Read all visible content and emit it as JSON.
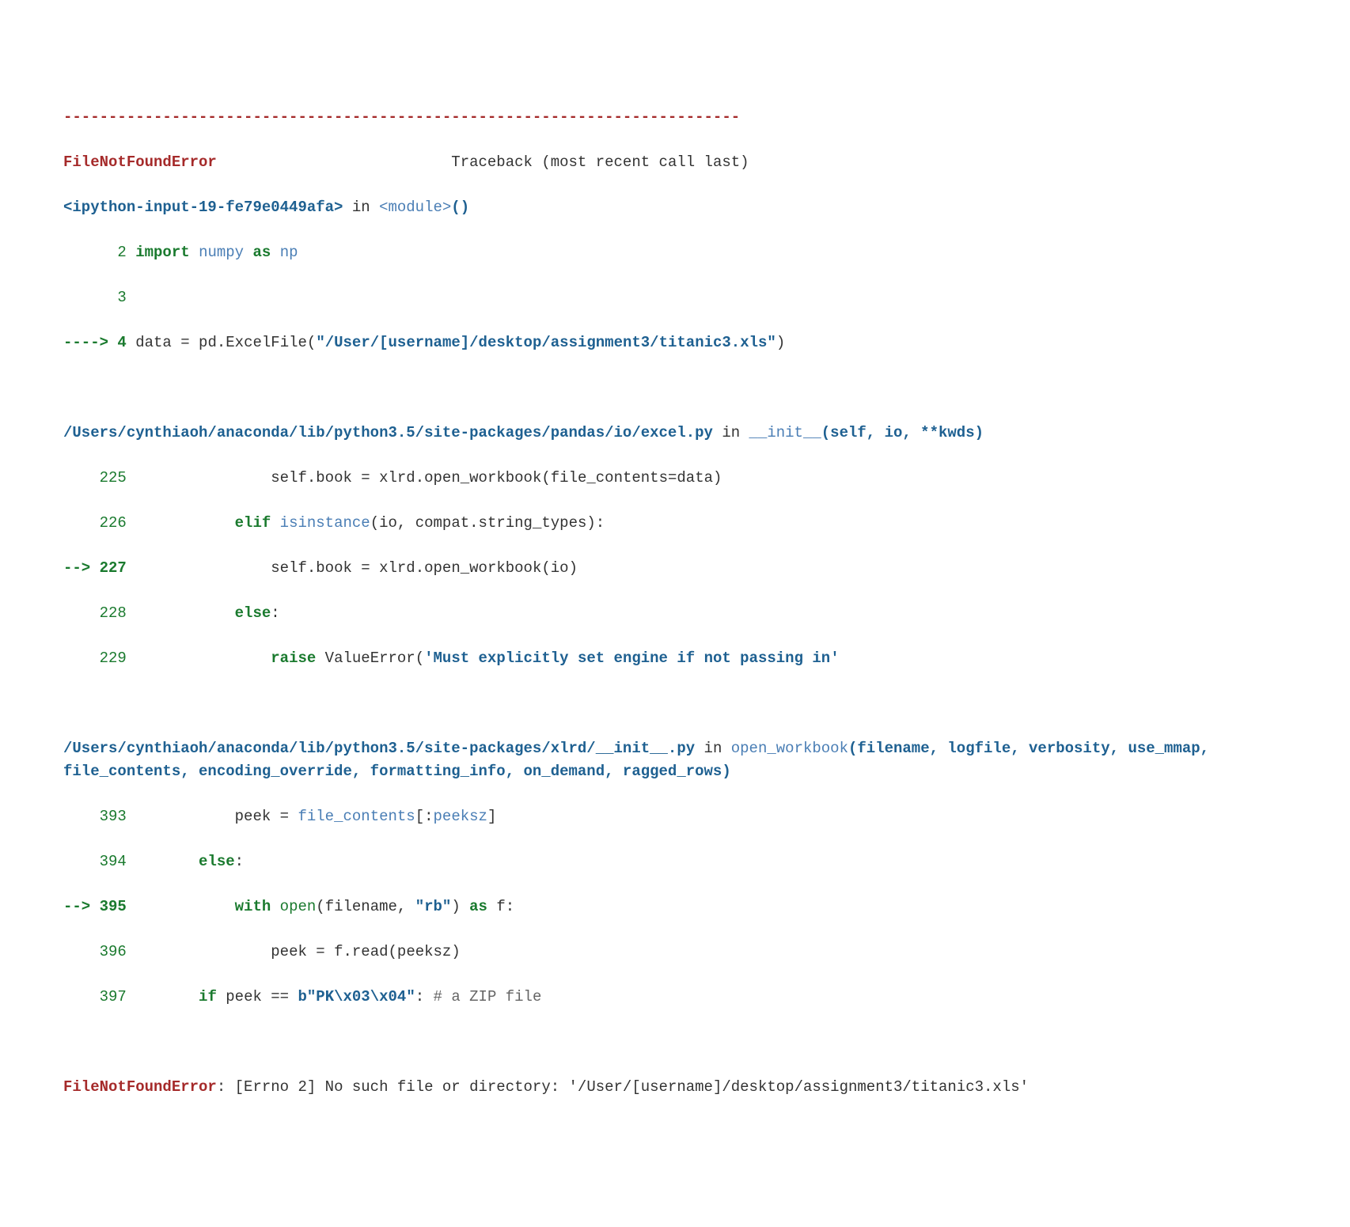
{
  "dashes": "---------------------------------------------------------------------------",
  "error_name": "FileNotFoundError",
  "traceback_label": "Traceback (most recent call last)",
  "frame0": {
    "path": "<ipython-input-19-fe79e0449afa>",
    "in": " in ",
    "func": "<module>",
    "args": "()",
    "l2_no": "      2",
    "l2_import": " import",
    "l2_numpy": "numpy",
    "l2_as": "as",
    "l2_np": "np",
    "l3_no": "      3",
    "l4_arrow": "----> 4",
    "l4_data": " data ",
    "l4_eq": "=",
    "l4_pd": " pd",
    "l4_dot": ".",
    "l4_excel": "ExcelFile",
    "l4_str": "\"/User/[username]/desktop/assignment3/titanic3.xls\""
  },
  "frame1": {
    "path": "/Users/cynthiaoh/anaconda/lib/python3.5/site-packages/pandas/io/excel.py",
    "in": " in ",
    "func": "__init__",
    "args": "(self, io, **kwds)",
    "l225_no": "    225",
    "l225_indent": "                self",
    "l225_book": ".book ",
    "l225_eq": "=",
    "l225_xlrd": " xlrd",
    "l225_dot": ".",
    "l225_open": "open_workbook",
    "l225_paren_open": "(",
    "l225_fc": "file_contents",
    "l225_eq2": "=",
    "l225_data": "data",
    "l225_paren_close": ")",
    "l226_no": "    226",
    "l226_indent": "            ",
    "l226_elif": "elif",
    "l226_isinst": " isinstance",
    "l226_paren_open": "(",
    "l226_io": "io",
    "l226_comma": ",",
    "l226_compat": " compat",
    "l226_dot": ".",
    "l226_st": "string_types",
    "l226_paren_close": "):",
    "l227_arrow": "--> 227",
    "l227_indent": "                ",
    "l227_self": "self",
    "l227_book": ".book ",
    "l227_eq": "=",
    "l227_xlrd": " xlrd",
    "l227_dot": ".",
    "l227_open": "open_workbook",
    "l227_paren_open": "(",
    "l227_io": "io",
    "l227_paren_close": ")",
    "l228_no": "    228",
    "l228_indent": "            ",
    "l228_else": "else",
    "l228_colon": ":",
    "l229_no": "    229",
    "l229_indent": "                ",
    "l229_raise": "raise",
    "l229_ve": " ValueError",
    "l229_paren": "(",
    "l229_str": "'Must explicitly set engine if not passing in'"
  },
  "frame2": {
    "path": "/Users/cynthiaoh/anaconda/lib/python3.5/site-packages/xlrd/__init__.py",
    "in": " in ",
    "func": "open_workbook",
    "args": "(filename, logfile, verbosity, use_mmap, file_contents, encoding_override, formatting_info, on_demand, ragged_rows)",
    "l393_no": "    393",
    "l393_indent": "            ",
    "l393_peek": "peek ",
    "l393_eq": "=",
    "l393_fc": " file_contents",
    "l393_slice": "[:",
    "l393_psz": "peeksz",
    "l393_close": "]",
    "l394_no": "    394",
    "l394_indent": "        ",
    "l394_else": "else",
    "l394_colon": ":",
    "l395_arrow": "--> 395",
    "l395_indent": "            ",
    "l395_with": "with",
    "l395_open": " open",
    "l395_paren": "(",
    "l395_filename": "filename",
    "l395_comma": ",",
    "l395_rb": " \"rb\"",
    "l395_paren2": ")",
    "l395_as": " as",
    "l395_f": " f",
    "l395_colon": ":",
    "l396_no": "    396",
    "l396_indent": "                ",
    "l396_peek": "peek ",
    "l396_eq": "=",
    "l396_f": " f",
    "l396_dot": ".",
    "l396_read": "read",
    "l396_paren": "(",
    "l396_psz": "peeksz",
    "l396_paren2": ")",
    "l397_no": "    397",
    "l397_indent": "        ",
    "l397_if": "if",
    "l397_peek": " peek ",
    "l397_eqeq": "==",
    "l397_bytes": " b\"PK\\x03\\x04\"",
    "l397_colon": ":",
    "l397_comment": " # a ZIP file"
  },
  "final": {
    "error_name": "FileNotFoundError",
    "colon": ": ",
    "msg": "[Errno 2] No such file or directory: '/User/[username]/desktop/assignment3/titanic3.xls'"
  }
}
